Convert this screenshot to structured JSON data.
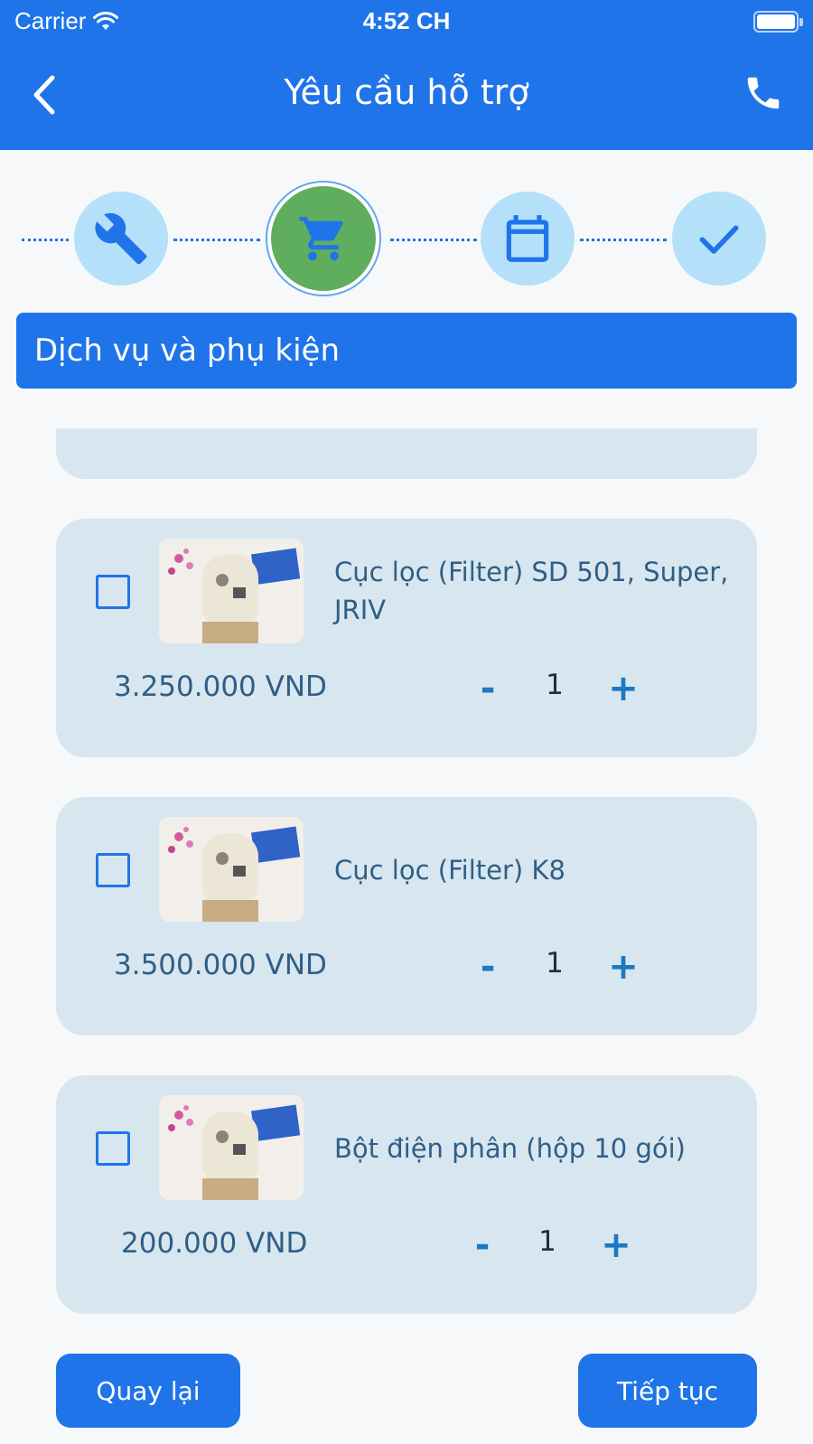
{
  "status_bar": {
    "carrier": "Carrier",
    "time": "4:52 CH"
  },
  "header": {
    "title": "Yêu cầu hỗ trợ",
    "back_icon": "chevron-left-icon",
    "call_icon": "phone-icon"
  },
  "stepper": {
    "steps": [
      {
        "icon": "wrench-icon",
        "state": "inactive"
      },
      {
        "icon": "cart-icon",
        "state": "active"
      },
      {
        "icon": "calendar-icon",
        "state": "inactive"
      },
      {
        "icon": "check-icon",
        "state": "inactive"
      }
    ]
  },
  "section": {
    "title": "Dịch vụ và phụ kiện"
  },
  "products": [
    {
      "name": "Cục lọc (Filter) SD 501, Super, JRIV",
      "price": "3.250.000 VND",
      "minus": "-",
      "quantity": "1",
      "plus": "+",
      "checked": false
    },
    {
      "name": "Cục lọc (Filter) K8",
      "price": "3.500.000 VND",
      "minus": "-",
      "quantity": "1",
      "plus": "+",
      "checked": false
    },
    {
      "name": "Bột điện phân (hộp 10 gói)",
      "price": "200.000 VND",
      "minus": "-",
      "quantity": "1",
      "plus": "+",
      "checked": false
    }
  ],
  "footer": {
    "back_label": "Quay lại",
    "next_label": "Tiếp tục"
  },
  "colors": {
    "primary": "#1f74ea",
    "step_inactive": "#b4e0fa",
    "step_active": "#5fae5d",
    "card": "#d8e6ef"
  }
}
